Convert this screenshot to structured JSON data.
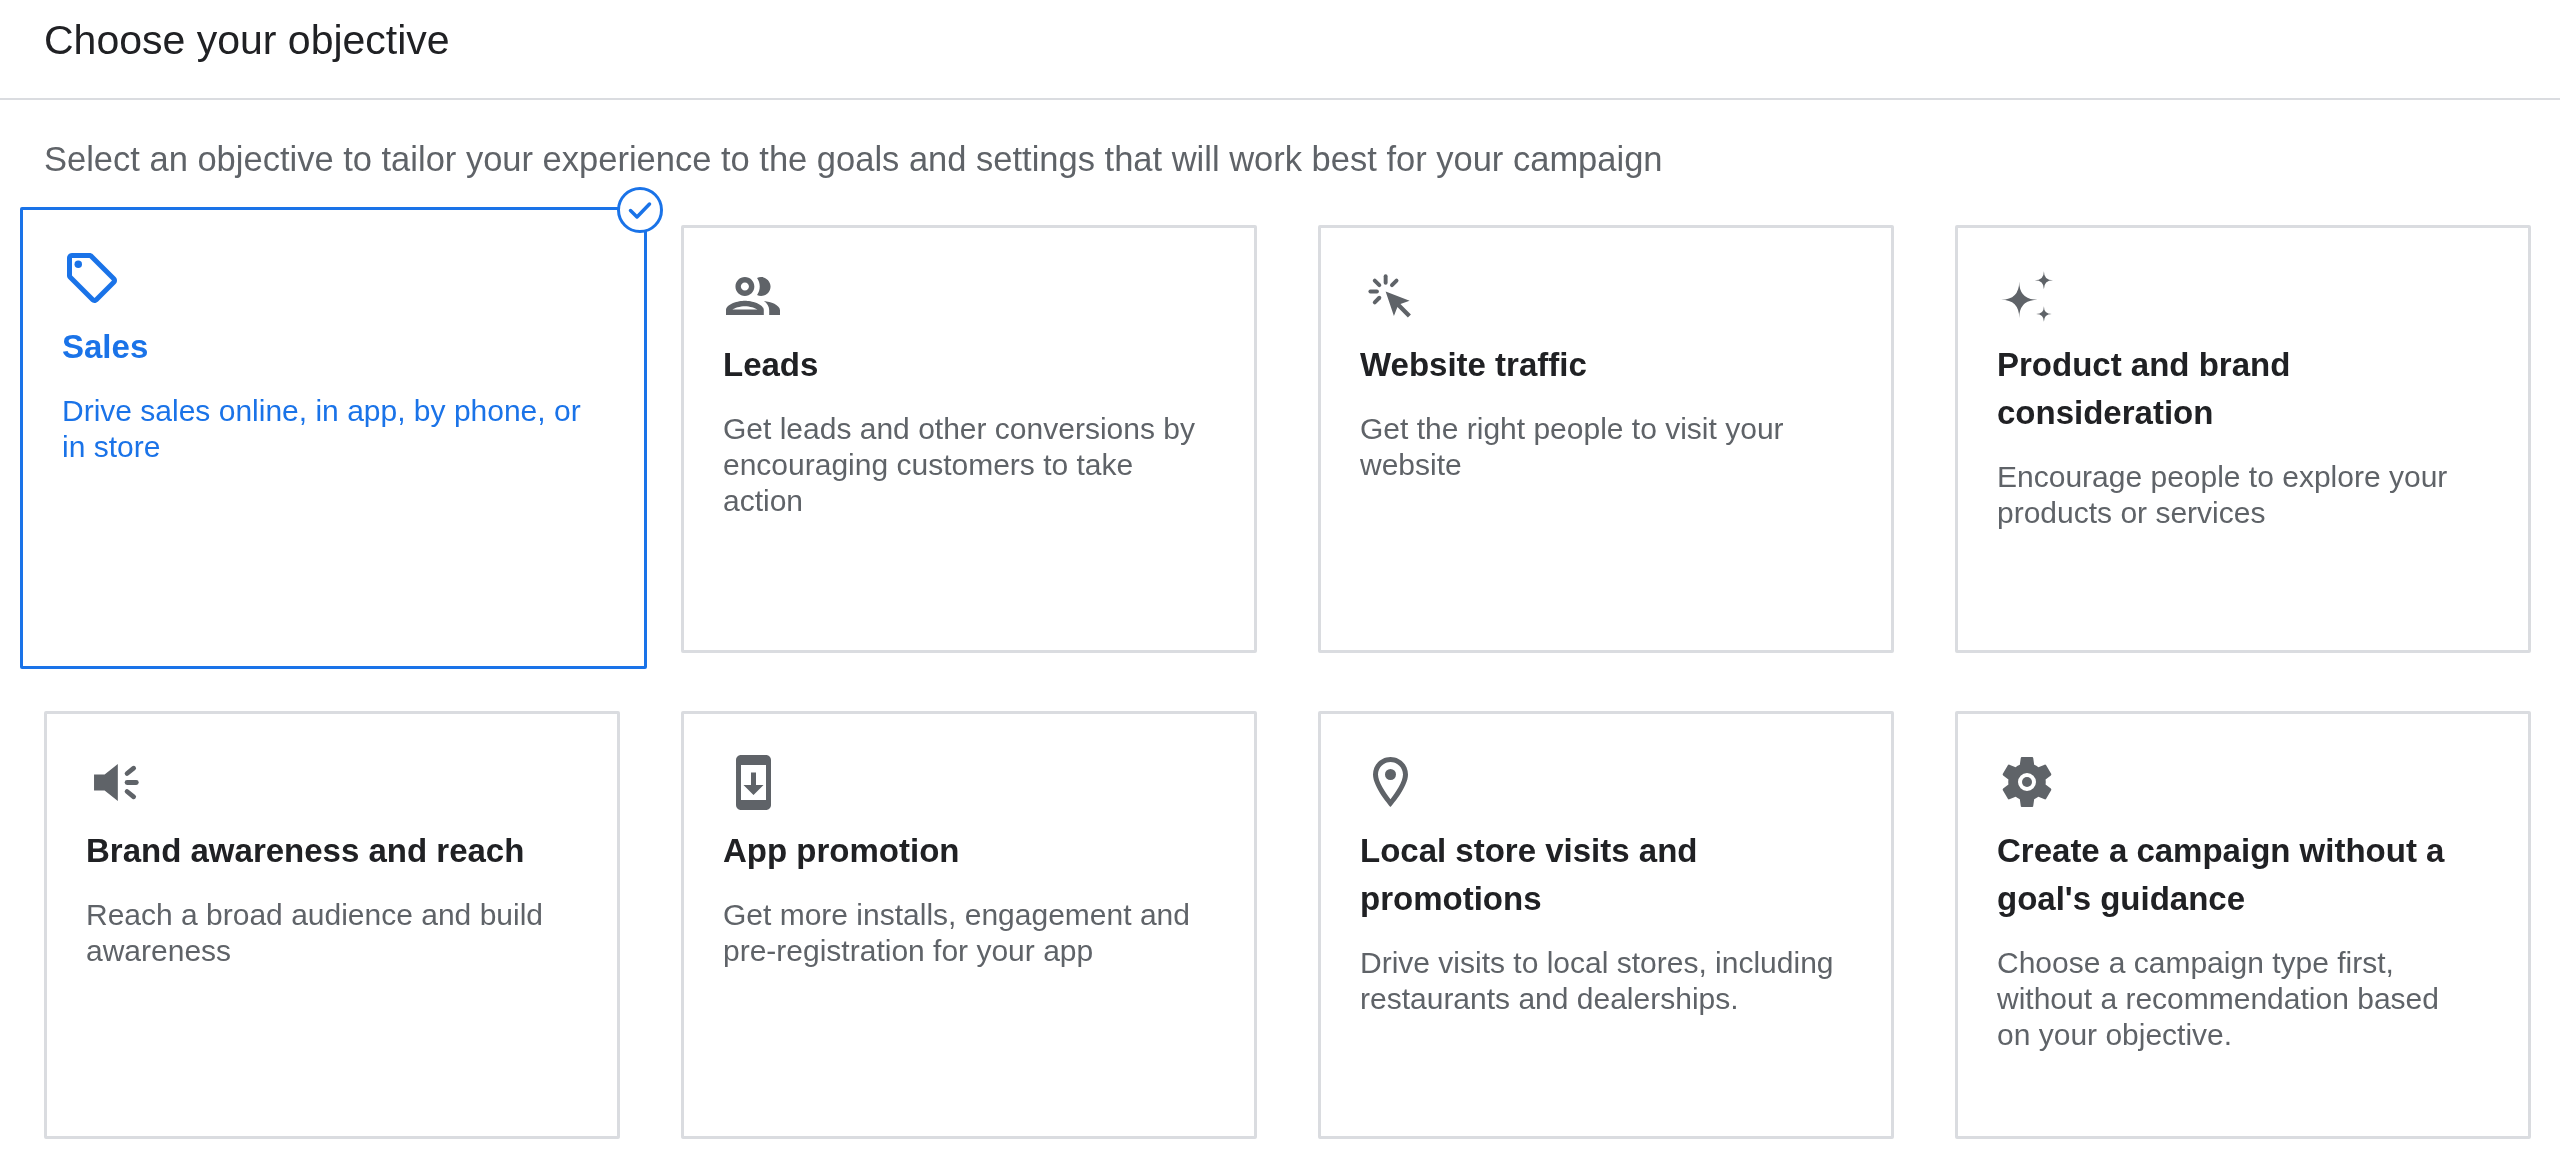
{
  "header": {
    "title": "Choose your objective"
  },
  "instructions": "Select an objective to tailor your experience to the goals and settings that will work best for your campaign",
  "objectives": [
    {
      "kind": "sales",
      "title": "Sales",
      "description": "Drive sales online, in app, by phone, or in store",
      "selected": true
    },
    {
      "kind": "leads",
      "title": "Leads",
      "description": "Get leads and other conversions by encouraging customers to take action",
      "selected": false
    },
    {
      "kind": "traffic",
      "title": "Website traffic",
      "description": "Get the right people to visit your website",
      "selected": false
    },
    {
      "kind": "consideration",
      "title": "Product and brand consideration",
      "description": "Encourage people to explore your products or services",
      "selected": false
    },
    {
      "kind": "awareness",
      "title": "Brand awareness and reach",
      "description": "Reach a broad audience and build awareness",
      "selected": false
    },
    {
      "kind": "app",
      "title": "App promotion",
      "description": "Get more installs, engagement and pre-registration for your app",
      "selected": false
    },
    {
      "kind": "local",
      "title": "Local store visits and promotions",
      "description": "Drive visits to local stores, including restaurants and dealerships.",
      "selected": false
    },
    {
      "kind": "custom",
      "title": "Create a campaign without a goal's guidance",
      "description": "Choose a campaign type first, without a recommendation based on your objective.",
      "selected": false
    }
  ]
}
